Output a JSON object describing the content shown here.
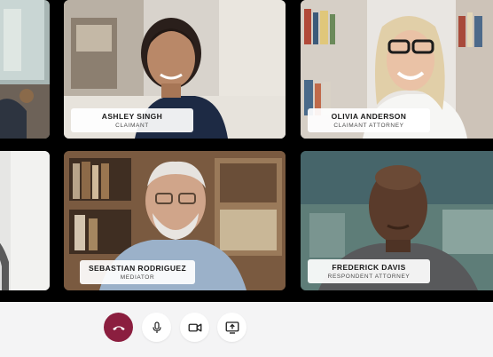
{
  "participants": [
    {
      "name": "ASHLEY SINGH",
      "role": "CLAIMANT"
    },
    {
      "name": "OLIVIA ANDERSON",
      "role": "CLAIMANT ATTORNEY"
    },
    {
      "name": "SEBASTIAN RODRIGUEZ",
      "role": "MEDIATOR"
    },
    {
      "name": "FREDERICK DAVIS",
      "role": "RESPONDENT ATTORNEY"
    }
  ],
  "controls": {
    "end_call": {
      "icon": "phone-hangup-icon",
      "color": "#8b1e3f"
    },
    "microphone": {
      "icon": "microphone-icon"
    },
    "camera": {
      "icon": "video-camera-icon"
    },
    "share_screen": {
      "icon": "share-screen-icon"
    }
  },
  "colors": {
    "end_call": "#8b1e3f",
    "toolbar_bg": "#f4f4f5",
    "grid_bg": "#000000"
  }
}
